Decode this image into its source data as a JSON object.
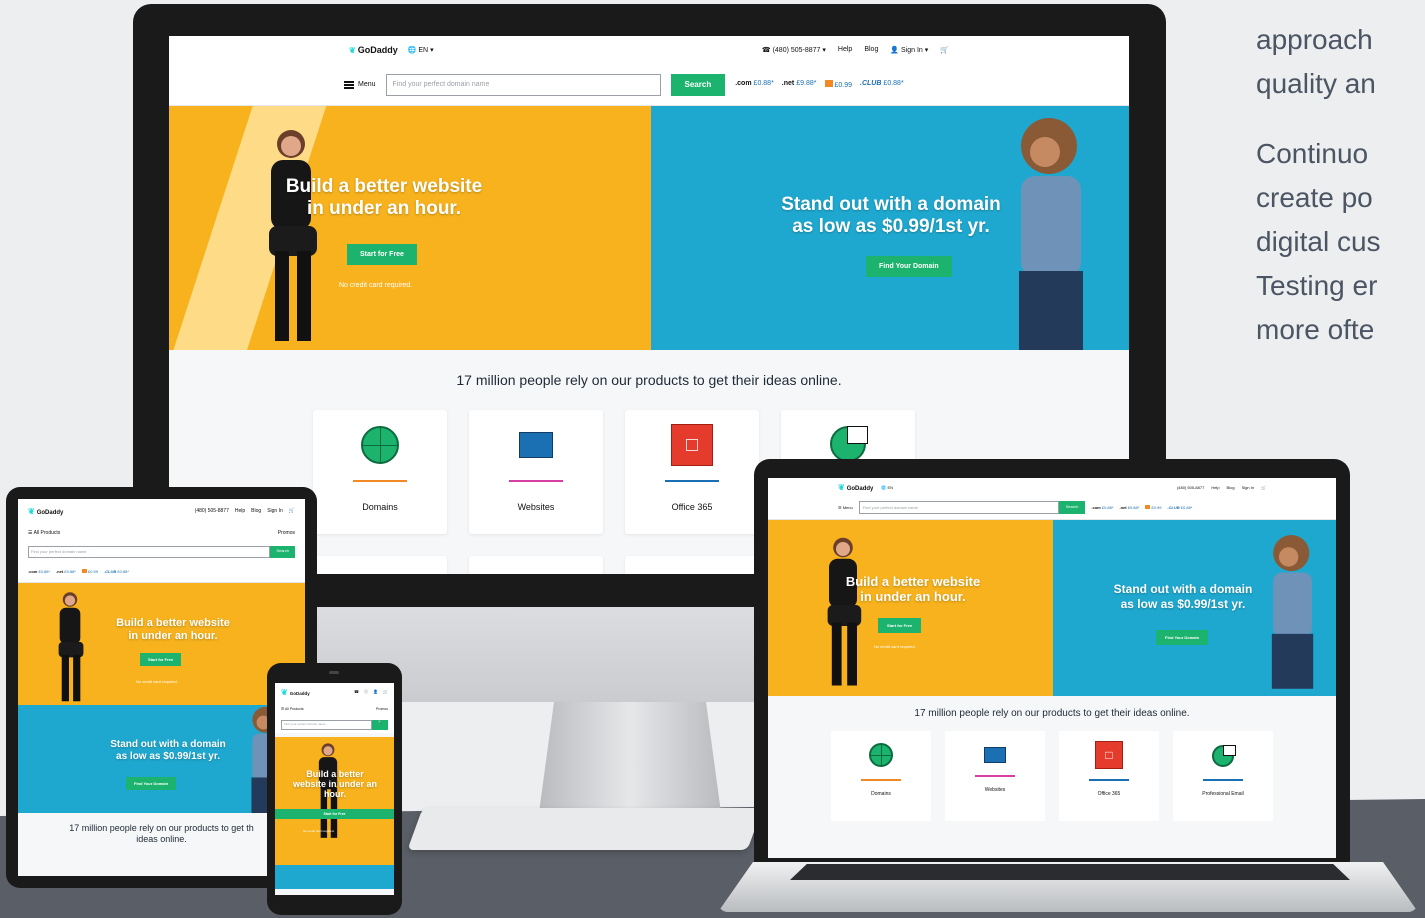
{
  "side_text": {
    "lines_a": [
      "approach",
      "quality an"
    ],
    "lines_b": [
      "Continuo",
      "create po",
      "digital cus",
      "Testing er",
      "more ofte"
    ]
  },
  "site": {
    "logo": "GoDaddy",
    "lang": "EN",
    "phone": "(480) 505-8877",
    "help": "Help",
    "blog": "Blog",
    "sign_in": "Sign In",
    "menu": "Menu",
    "all_products": "All Products",
    "search_placeholder": "Find your perfect domain name",
    "search_btn": "Search",
    "tlds": [
      {
        "name": ".com",
        "price": "£0.88*"
      },
      {
        "name": ".net",
        "price": "£9.88*"
      },
      {
        "name": "",
        "price": "£0.99"
      },
      {
        "name": ".CLUB",
        "price": "£0.88*"
      }
    ],
    "hero_left_title_1": "Build a better website",
    "hero_left_title_2": "in under an hour.",
    "hero_left_btn": "Start for Free",
    "hero_left_note": "No credit card required.",
    "hero_right_title_1": "Stand out with a domain",
    "hero_right_title_2": "as low as $0.99/1st yr.",
    "hero_right_btn": "Find Your Domain",
    "tagline": "17 million people rely on our products to get their ideas online.",
    "tablet_tagline_1": "17 million people rely on our products to get th",
    "tablet_tagline_2": "ideas online.",
    "promos": "Promos",
    "phone_left_title": "Build a better website in under an hour.",
    "products": [
      {
        "label": "Domains",
        "icon": "globe-icon",
        "color": "#f08a24"
      },
      {
        "label": "Websites",
        "icon": "website-icon",
        "color": "#d63fa6"
      },
      {
        "label": "Office 365",
        "icon": "office-icon",
        "color": "#1b6fb3"
      },
      {
        "label": "Professional Email",
        "icon": "email-icon",
        "color": "#1b6fb3"
      }
    ]
  }
}
